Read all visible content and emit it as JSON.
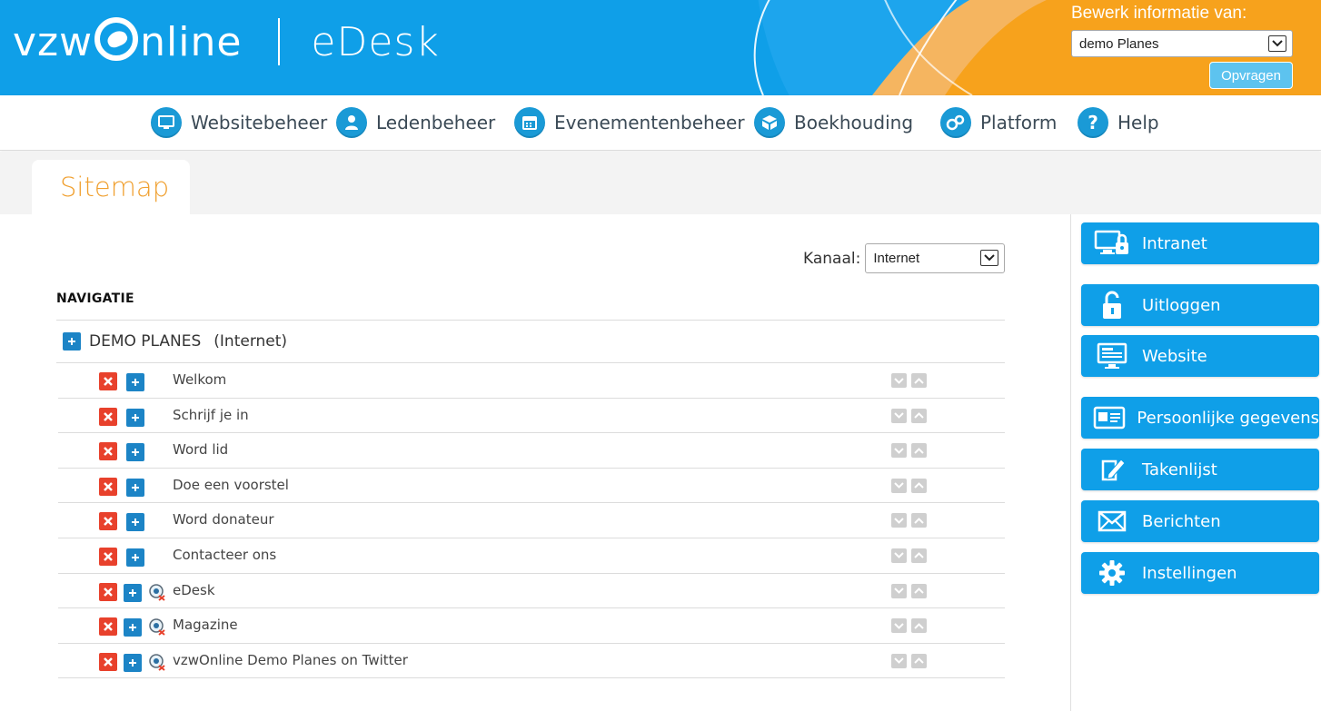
{
  "header": {
    "logo_text_left": "vzw",
    "logo_text_right": "nline",
    "product": "eDesk",
    "bewerk_label": "Bewerk informatie van:",
    "organisation_select": "demo Planes",
    "opvragen_label": "Opvragen",
    "colors": {
      "primary": "#0f9fe8",
      "accent_orange": "#f7a21c"
    }
  },
  "topnav": {
    "items": [
      {
        "label": "Websitebeheer",
        "icon": "monitor-icon"
      },
      {
        "label": "Ledenbeheer",
        "icon": "person-icon"
      },
      {
        "label": "Evenementenbeheer",
        "icon": "calendar-icon"
      },
      {
        "label": "Boekhouding",
        "icon": "box-icon"
      },
      {
        "label": "Platform",
        "icon": "gears-icon"
      },
      {
        "label": "Help",
        "icon": "question-icon"
      }
    ]
  },
  "page": {
    "tab_title": "Sitemap",
    "kanaal_label": "Kanaal:",
    "kanaal_value": "Internet",
    "section_heading": "NAVIGATIE"
  },
  "tree": {
    "root_title": "DEMO PLANES",
    "root_channel": "(Internet)",
    "items": [
      {
        "label": "Welkom",
        "external": false
      },
      {
        "label": "Schrijf je in",
        "external": false
      },
      {
        "label": "Word lid",
        "external": false
      },
      {
        "label": "Doe een voorstel",
        "external": false
      },
      {
        "label": "Word donateur",
        "external": false
      },
      {
        "label": "Contacteer ons",
        "external": false
      },
      {
        "label": "eDesk",
        "external": true
      },
      {
        "label": "Magazine",
        "external": true
      },
      {
        "label": "vzwOnline Demo Planes on Twitter",
        "external": true
      }
    ]
  },
  "sidebar": {
    "buttons": [
      {
        "label": "Intranet",
        "icon": "intranet-lock-icon"
      },
      {
        "label": "Uitloggen",
        "icon": "padlock-open-icon"
      },
      {
        "label": "Website",
        "icon": "website-monitor-icon"
      },
      {
        "label": "Persoonlijke gegevens",
        "icon": "id-card-icon"
      },
      {
        "label": "Takenlijst",
        "icon": "pencil-note-icon"
      },
      {
        "label": "Berichten",
        "icon": "envelope-icon"
      },
      {
        "label": "Instellingen",
        "icon": "gear-icon"
      }
    ]
  }
}
